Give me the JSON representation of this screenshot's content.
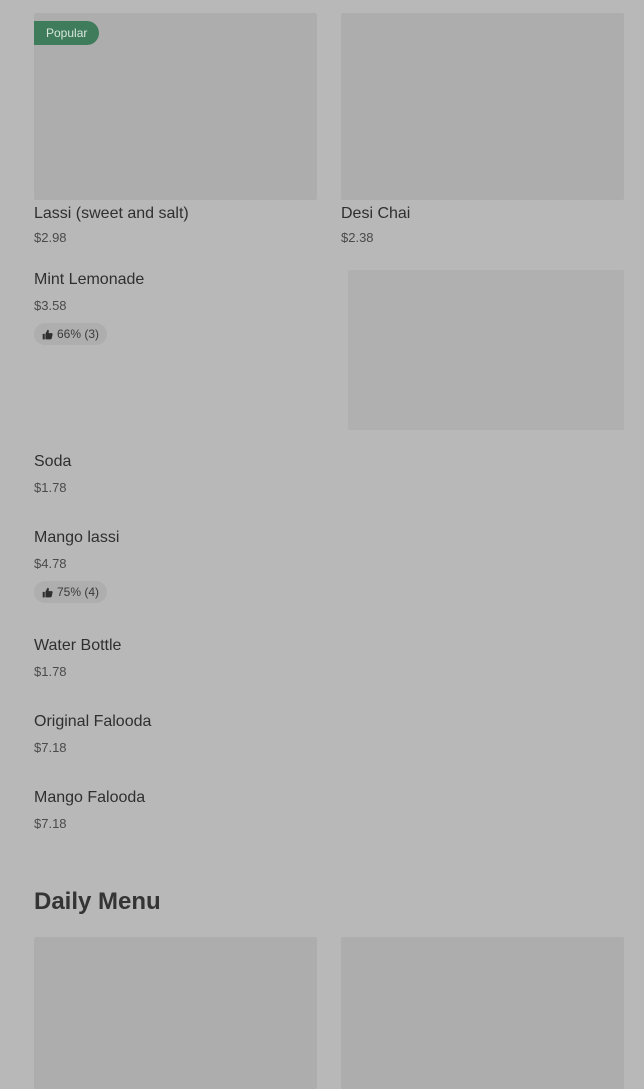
{
  "featured": [
    {
      "name": "Lassi (sweet and salt)",
      "price": "$2.98",
      "badge": "Popular"
    },
    {
      "name": "Desi Chai",
      "price": "$2.38"
    }
  ],
  "items": [
    {
      "name": "Mint Lemonade",
      "price": "$3.58",
      "rating": "66% (3)"
    },
    {
      "name": "Soda",
      "price": "$1.78"
    },
    {
      "name": "Mango lassi",
      "price": "$4.78",
      "rating": "75% (4)"
    },
    {
      "name": "Water Bottle",
      "price": "$1.78"
    },
    {
      "name": "Original Falooda",
      "price": "$7.18"
    },
    {
      "name": "Mango Falooda",
      "price": "$7.18"
    }
  ],
  "daily_menu": {
    "title": "Daily Menu"
  },
  "icons": {
    "rating": "thumbs-up-icon"
  },
  "colors": {
    "badge": "#3f7c5c",
    "background": "#b8b8b8",
    "image_placeholder": "#adadad"
  }
}
